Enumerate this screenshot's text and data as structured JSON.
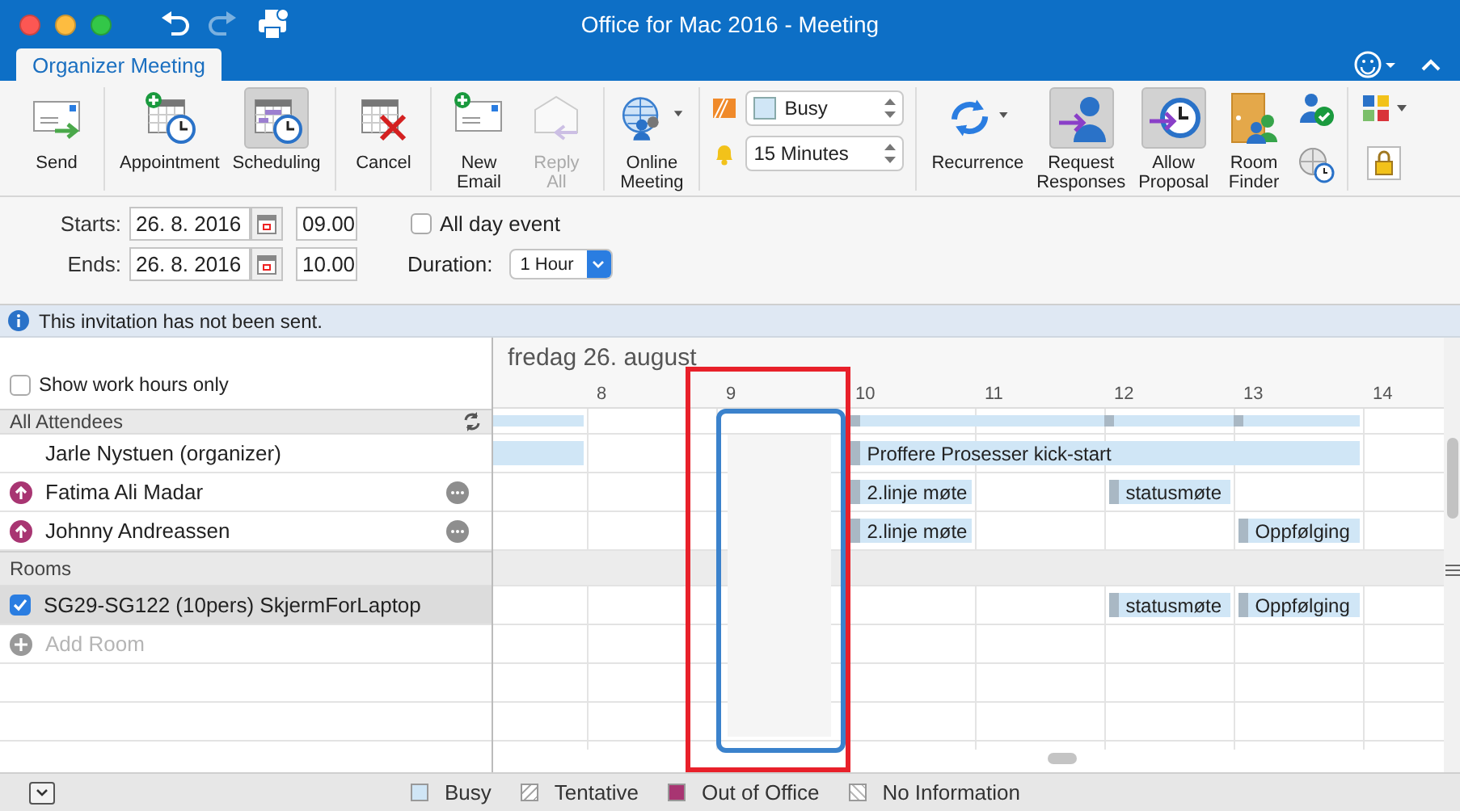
{
  "window": {
    "title": "Office for Mac 2016 - Meeting"
  },
  "tabs": [
    {
      "label": "Organizer Meeting",
      "selected": true
    }
  ],
  "ribbon": {
    "groups": [
      [
        {
          "kind": "large",
          "label": "Send",
          "selected": false,
          "disabled": false
        }
      ],
      [
        {
          "kind": "large",
          "label": "Appointment",
          "selected": false,
          "disabled": false
        },
        {
          "kind": "large",
          "label": "Scheduling",
          "selected": true,
          "disabled": false
        }
      ],
      [
        {
          "kind": "large",
          "label": "Cancel",
          "selected": false,
          "disabled": false
        }
      ],
      [
        {
          "kind": "large",
          "label": "New Email",
          "selected": false,
          "disabled": false
        },
        {
          "kind": "large",
          "label": "Reply All",
          "selected": false,
          "disabled": true
        }
      ],
      [
        {
          "kind": "large",
          "label": "Online Meeting",
          "selected": false,
          "disabled": false
        }
      ],
      [
        {
          "kind": "select_stack",
          "selects": [
            {
              "value": "Busy"
            },
            {
              "value": "15 Minutes"
            }
          ]
        }
      ],
      [
        {
          "kind": "large",
          "label": "Recurrence",
          "selected": false,
          "disabled": false
        },
        {
          "kind": "large",
          "label": "Request Responses",
          "selected": true,
          "disabled": false
        },
        {
          "kind": "large",
          "label": "Allow Proposal",
          "selected": true,
          "disabled": false
        },
        {
          "kind": "large",
          "label": "Room Finder",
          "selected": false,
          "disabled": false
        },
        {
          "kind": "icon_stack"
        }
      ],
      [
        {
          "kind": "icon_stack"
        }
      ]
    ]
  },
  "times": {
    "starts_label": "Starts:",
    "start_date": "26. 8. 2016",
    "start_time": "09.00",
    "ends_label": "Ends:",
    "end_date": "26. 8. 2016",
    "end_time": "10.00",
    "all_day": {
      "label": "All day event",
      "checked": false
    },
    "duration_label": "Duration:",
    "duration": "1 Hour"
  },
  "info_bar": {
    "message": "This invitation has not been sent."
  },
  "schedule": {
    "date_heading": "fredag 26. august",
    "hours": [
      "8",
      "9",
      "10",
      "11",
      "12",
      "13",
      "14"
    ],
    "show_work_hours_only": {
      "label": "Show work hours only",
      "checked": false
    },
    "attendees_heading": "All Attendees",
    "summary_events": [
      {
        "kind": "busy"
      },
      {
        "kind": "busy"
      },
      {
        "kind": "busy"
      },
      {
        "kind": "busy"
      }
    ],
    "attendees": [
      {
        "name": "Jarle Nystuen (organizer)",
        "kind": "organizer",
        "events": [
          {
            "kind": "busy"
          },
          {
            "kind": "busy",
            "title": "Proffere Prosesser kick-start"
          }
        ]
      },
      {
        "name": "Fatima Ali Madar",
        "kind": "required",
        "events": [
          {
            "kind": "busy",
            "title": "2.linje møte"
          },
          {
            "kind": "busy",
            "title": "statusmøte"
          }
        ]
      },
      {
        "name": "Johnny Andreassen",
        "kind": "required",
        "events": [
          {
            "kind": "busy",
            "title": "2.linje møte"
          },
          {
            "kind": "busy",
            "title": "Oppfølging"
          }
        ]
      }
    ],
    "rooms_heading": "Rooms",
    "rooms": [
      {
        "name": "SG29-SG122 (10pers) SkjermForLaptop",
        "checked": true,
        "selected": true,
        "events": [
          {
            "kind": "busy",
            "title": "statusmøte"
          },
          {
            "kind": "busy",
            "title": "Oppfølging"
          }
        ]
      }
    ],
    "add_room": {
      "placeholder": "Add Room"
    }
  },
  "legend": [
    {
      "kind": "busy",
      "label": "Busy"
    },
    {
      "kind": "tentative",
      "label": "Tentative"
    },
    {
      "kind": "out_of_office",
      "label": "Out of Office"
    },
    {
      "kind": "no_information",
      "label": "No Information"
    }
  ]
}
